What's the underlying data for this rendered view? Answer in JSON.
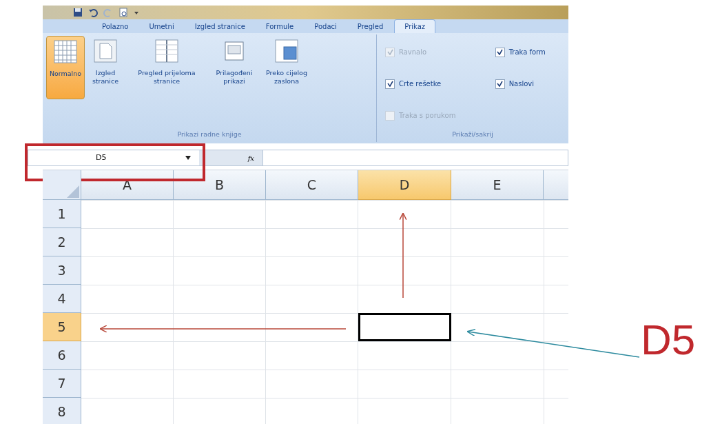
{
  "tabs": [
    {
      "label": "Polazno",
      "selected": false
    },
    {
      "label": "Umetni",
      "selected": false
    },
    {
      "label": "Izgled stranice",
      "selected": false
    },
    {
      "label": "Formule",
      "selected": false
    },
    {
      "label": "Podaci",
      "selected": false
    },
    {
      "label": "Pregled",
      "selected": false
    },
    {
      "label": "Prikaz",
      "selected": true
    }
  ],
  "ribbon": {
    "view_group": {
      "label": "Prikazi radne knjige",
      "buttons": [
        {
          "label": "Normalno",
          "kind": "normal",
          "selected": true
        },
        {
          "label": "Izgled stranice",
          "kind": "page",
          "selected": false
        },
        {
          "label": "Pregled prijeloma stranice",
          "kind": "break",
          "selected": false
        },
        {
          "label": "Prilagođeni prikazi",
          "kind": "custom",
          "selected": false
        },
        {
          "label": "Preko cijelog zaslona",
          "kind": "full",
          "selected": false
        }
      ]
    },
    "show_group": {
      "label": "Prikaži/sakrij",
      "checkboxes": [
        {
          "label": "Ravnalo",
          "checked": true,
          "disabled": true
        },
        {
          "label": "Crte rešetke",
          "checked": true,
          "disabled": false
        },
        {
          "label": "Traka s porukom",
          "checked": false,
          "disabled": true
        },
        {
          "label": "Traka form",
          "checked": true,
          "disabled": false
        },
        {
          "label": "Naslovi",
          "checked": true,
          "disabled": false
        }
      ]
    }
  },
  "name_box": {
    "value": "D5"
  },
  "formula_bar": {
    "fx": "fx"
  },
  "grid": {
    "columns": [
      {
        "label": "A",
        "selected": false
      },
      {
        "label": "B",
        "selected": false
      },
      {
        "label": "C",
        "selected": false
      },
      {
        "label": "D",
        "selected": true
      },
      {
        "label": "E",
        "selected": false
      }
    ],
    "rows": [
      {
        "label": "1",
        "selected": false
      },
      {
        "label": "2",
        "selected": false
      },
      {
        "label": "3",
        "selected": false
      },
      {
        "label": "4",
        "selected": false
      },
      {
        "label": "5",
        "selected": true
      },
      {
        "label": "6",
        "selected": false
      },
      {
        "label": "7",
        "selected": false
      },
      {
        "label": "8",
        "selected": false
      }
    ]
  },
  "annotation": {
    "label": "D5"
  }
}
